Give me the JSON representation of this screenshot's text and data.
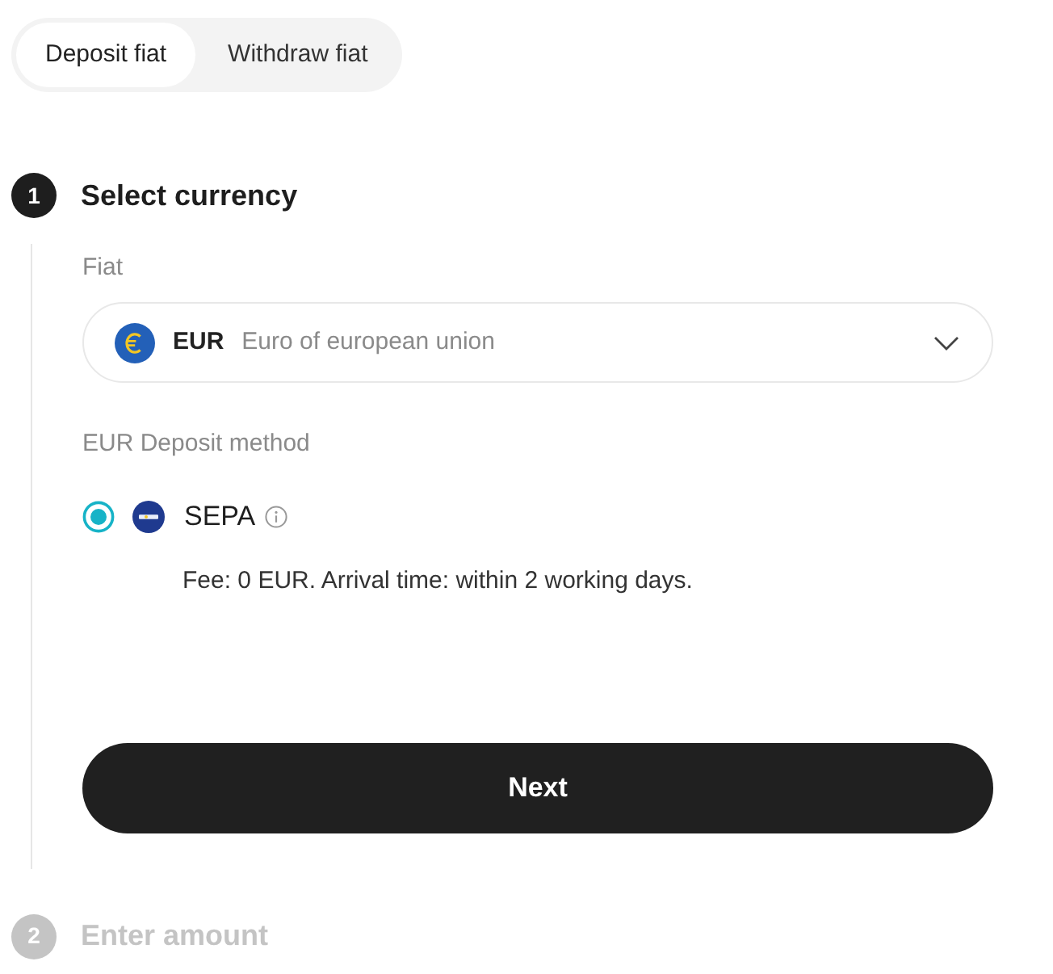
{
  "tabs": [
    {
      "label": "Deposit fiat",
      "selected": true
    },
    {
      "label": "Withdraw fiat",
      "selected": false
    }
  ],
  "steps": [
    {
      "number": "1",
      "title": "Select currency",
      "active": true,
      "fiat": {
        "label": "Fiat",
        "code": "EUR",
        "name": "Euro of european union"
      },
      "method": {
        "label": "EUR Deposit method",
        "options": [
          {
            "name": "SEPA",
            "selected": true,
            "description": "Fee: 0 EUR. Arrival time: within 2 working days."
          }
        ]
      },
      "button": "Next"
    },
    {
      "number": "2",
      "title": "Enter amount",
      "active": false
    }
  ]
}
